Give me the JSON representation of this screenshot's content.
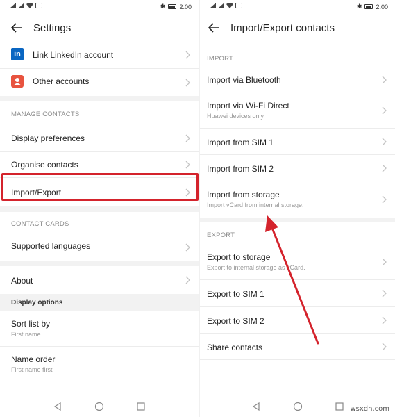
{
  "status": {
    "time": "2:00"
  },
  "left": {
    "title": "Settings",
    "accounts": [
      {
        "label": "Link LinkedIn account",
        "icon": "linkedin-icon"
      },
      {
        "label": "Other accounts",
        "icon": "account-icon"
      }
    ],
    "manage_header": "MANAGE CONTACTS",
    "manage_items": [
      {
        "label": "Display preferences"
      },
      {
        "label": "Organise contacts"
      },
      {
        "label": "Import/Export"
      }
    ],
    "cards_header": "CONTACT CARDS",
    "cards_items": [
      {
        "label": "Supported languages"
      }
    ],
    "about": "About",
    "display_options_header": "Display options",
    "display_items": [
      {
        "label": "Sort list by",
        "sub": "First name"
      },
      {
        "label": "Name order",
        "sub": "First name first"
      }
    ]
  },
  "right": {
    "title": "Import/Export contacts",
    "import_header": "IMPORT",
    "import_items": [
      {
        "label": "Import via Bluetooth",
        "sub": ""
      },
      {
        "label": "Import via Wi-Fi Direct",
        "sub": "Huawei devices only"
      },
      {
        "label": "Import from SIM 1",
        "sub": ""
      },
      {
        "label": "Import from SIM 2",
        "sub": ""
      },
      {
        "label": "Import from storage",
        "sub": "Import vCard from internal storage."
      }
    ],
    "export_header": "EXPORT",
    "export_items": [
      {
        "label": "Export to storage",
        "sub": "Export to internal storage as vCard."
      },
      {
        "label": "Export to SIM 1",
        "sub": ""
      },
      {
        "label": "Export to SIM 2",
        "sub": ""
      },
      {
        "label": "Share contacts",
        "sub": ""
      }
    ]
  },
  "colors": {
    "highlight": "#d4232c",
    "linkedin": "#0a66c2",
    "account": "#e8533f"
  },
  "watermark": "wsxdn.com"
}
